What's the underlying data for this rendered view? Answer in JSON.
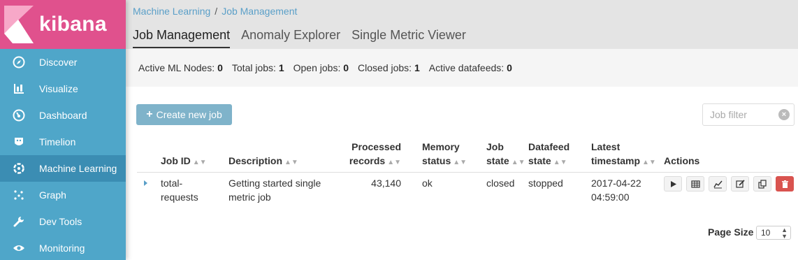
{
  "app": {
    "logo_text": "kibana"
  },
  "sidebar": {
    "items": [
      {
        "label": "Discover",
        "icon": "compass-icon"
      },
      {
        "label": "Visualize",
        "icon": "bar-chart-icon"
      },
      {
        "label": "Dashboard",
        "icon": "dashboard-icon"
      },
      {
        "label": "Timelion",
        "icon": "timelion-icon"
      },
      {
        "label": "Machine Learning",
        "icon": "machine-learning-icon",
        "active": true
      },
      {
        "label": "Graph",
        "icon": "graph-icon"
      },
      {
        "label": "Dev Tools",
        "icon": "wrench-icon"
      },
      {
        "label": "Monitoring",
        "icon": "eye-icon"
      }
    ]
  },
  "breadcrumb": {
    "root": "Machine Learning",
    "separator": "/",
    "current": "Job Management"
  },
  "tabs": [
    {
      "label": "Job Management",
      "active": true
    },
    {
      "label": "Anomaly Explorer"
    },
    {
      "label": "Single Metric Viewer"
    }
  ],
  "stats": [
    {
      "label": "Active ML Nodes:",
      "value": "0"
    },
    {
      "label": "Total jobs:",
      "value": "1"
    },
    {
      "label": "Open jobs:",
      "value": "0"
    },
    {
      "label": "Closed jobs:",
      "value": "1"
    },
    {
      "label": "Active datafeeds:",
      "value": "0"
    }
  ],
  "toolbar": {
    "create_label": "Create new job",
    "filter_placeholder": "Job filter"
  },
  "table": {
    "headers": {
      "job_id": "Job ID",
      "description": "Description",
      "processed_1": "Processed",
      "processed_2": "records",
      "memory_1": "Memory",
      "memory_2": "status",
      "jobstate_1": "Job",
      "jobstate_2": "state",
      "datafeed_1": "Datafeed",
      "datafeed_2": "state",
      "latest_1": "Latest",
      "latest_2": "timestamp",
      "actions": "Actions"
    },
    "rows": [
      {
        "job_id_1": "total-",
        "job_id_2": "requests",
        "description_1": "Getting started single",
        "description_2": "metric job",
        "processed_records": "43,140",
        "memory_status": "ok",
        "job_state": "closed",
        "datafeed_state": "stopped",
        "latest_date": "2017-04-22",
        "latest_time": "04:59:00"
      }
    ],
    "action_icons": [
      "play-icon",
      "table-icon",
      "line-chart-icon",
      "edit-icon",
      "clone-icon",
      "delete-icon"
    ]
  },
  "pagination": {
    "page_size_label": "Page Size",
    "page_size_value": "10"
  },
  "colors": {
    "sidebar": "#4fa6c9",
    "sidebar_active": "#3b8db3",
    "logo_bg": "#e0518d",
    "link": "#5a9fc8",
    "danger": "#d9534f",
    "primary_btn": "#7fb3ca"
  }
}
